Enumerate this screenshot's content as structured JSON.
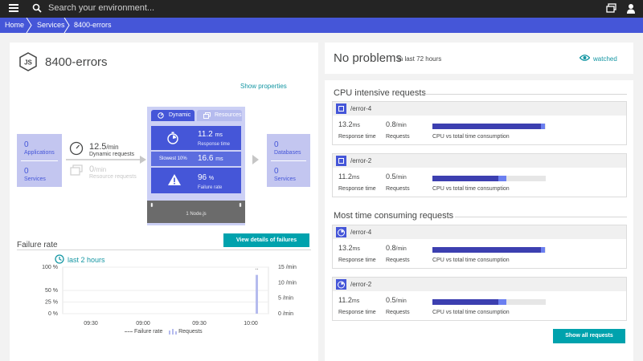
{
  "topbar": {
    "search_placeholder": "Search your environment..."
  },
  "breadcrumb": [
    "Home",
    "Services",
    "8400-errors"
  ],
  "service": {
    "title": "8400-errors",
    "show_properties": "Show properties"
  },
  "flow": {
    "callers": [
      {
        "num": "0",
        "label": "Applications"
      },
      {
        "num": "0",
        "label": "Services"
      }
    ],
    "dynamic_requests": {
      "value": "12.5",
      "unit": "/min",
      "label": "Dynamic requests"
    },
    "resource_requests": {
      "value": "0",
      "unit": "/min",
      "label": "Resource requests"
    },
    "tabs": [
      "Dynamic",
      "Resources"
    ],
    "response_time": {
      "value": "11.2",
      "unit": "ms",
      "label": "Response time"
    },
    "slowest": {
      "label": "Slowest 10%",
      "value": "16.6",
      "unit": "ms"
    },
    "failure_rate": {
      "value": "96",
      "unit": "%",
      "label": "Failure rate"
    },
    "process": "1 Node.js",
    "callees": [
      {
        "num": "0",
        "label": "Databases"
      },
      {
        "num": "0",
        "label": "Services"
      }
    ],
    "view_failures": "View details of failures"
  },
  "failure_chart": {
    "title": "Failure rate",
    "timeframe": "last 2 hours",
    "legend": [
      "Failure rate",
      "Requests"
    ]
  },
  "chart_data": {
    "type": "bar",
    "x_ticks": [
      "09:30",
      "09:00",
      "09:30",
      "10:00"
    ],
    "y_left_ticks": [
      "100 %",
      "50 %",
      "25 %",
      "0 %"
    ],
    "y_right_ticks": [
      "15 /min",
      "10 /min",
      "5 /min",
      "0 /min"
    ],
    "series": [
      {
        "name": "Failure rate",
        "values": [
          96
        ]
      },
      {
        "name": "Requests",
        "values": [
          12.5
        ]
      }
    ]
  },
  "status": {
    "title": "No problems",
    "subtitle": "in last 72 hours",
    "watched": "watched"
  },
  "cpu_section": {
    "title": "CPU intensive requests",
    "items": [
      {
        "name": "/error-4",
        "rt": "13.2",
        "rt_unit": "ms",
        "req": "0.8",
        "req_unit": "/min",
        "fill": 0.96,
        "fill2": 0.03
      },
      {
        "name": "/error-2",
        "rt": "11.2",
        "rt_unit": "ms",
        "req": "0.5",
        "req_unit": "/min",
        "fill": 0.58,
        "fill2": 0.07
      }
    ]
  },
  "time_section": {
    "title": "Most time consuming requests",
    "items": [
      {
        "name": "/error-4",
        "rt": "13.2",
        "rt_unit": "ms",
        "req": "0.8",
        "req_unit": "/min",
        "fill": 0.96,
        "fill2": 0.03
      },
      {
        "name": "/error-2",
        "rt": "11.2",
        "rt_unit": "ms",
        "req": "0.5",
        "req_unit": "/min",
        "fill": 0.58,
        "fill2": 0.07
      }
    ]
  },
  "labels": {
    "response_time": "Response time",
    "requests": "Requests",
    "cpu_vs_total": "CPU vs total time consumption",
    "show_all": "Show all requests"
  }
}
